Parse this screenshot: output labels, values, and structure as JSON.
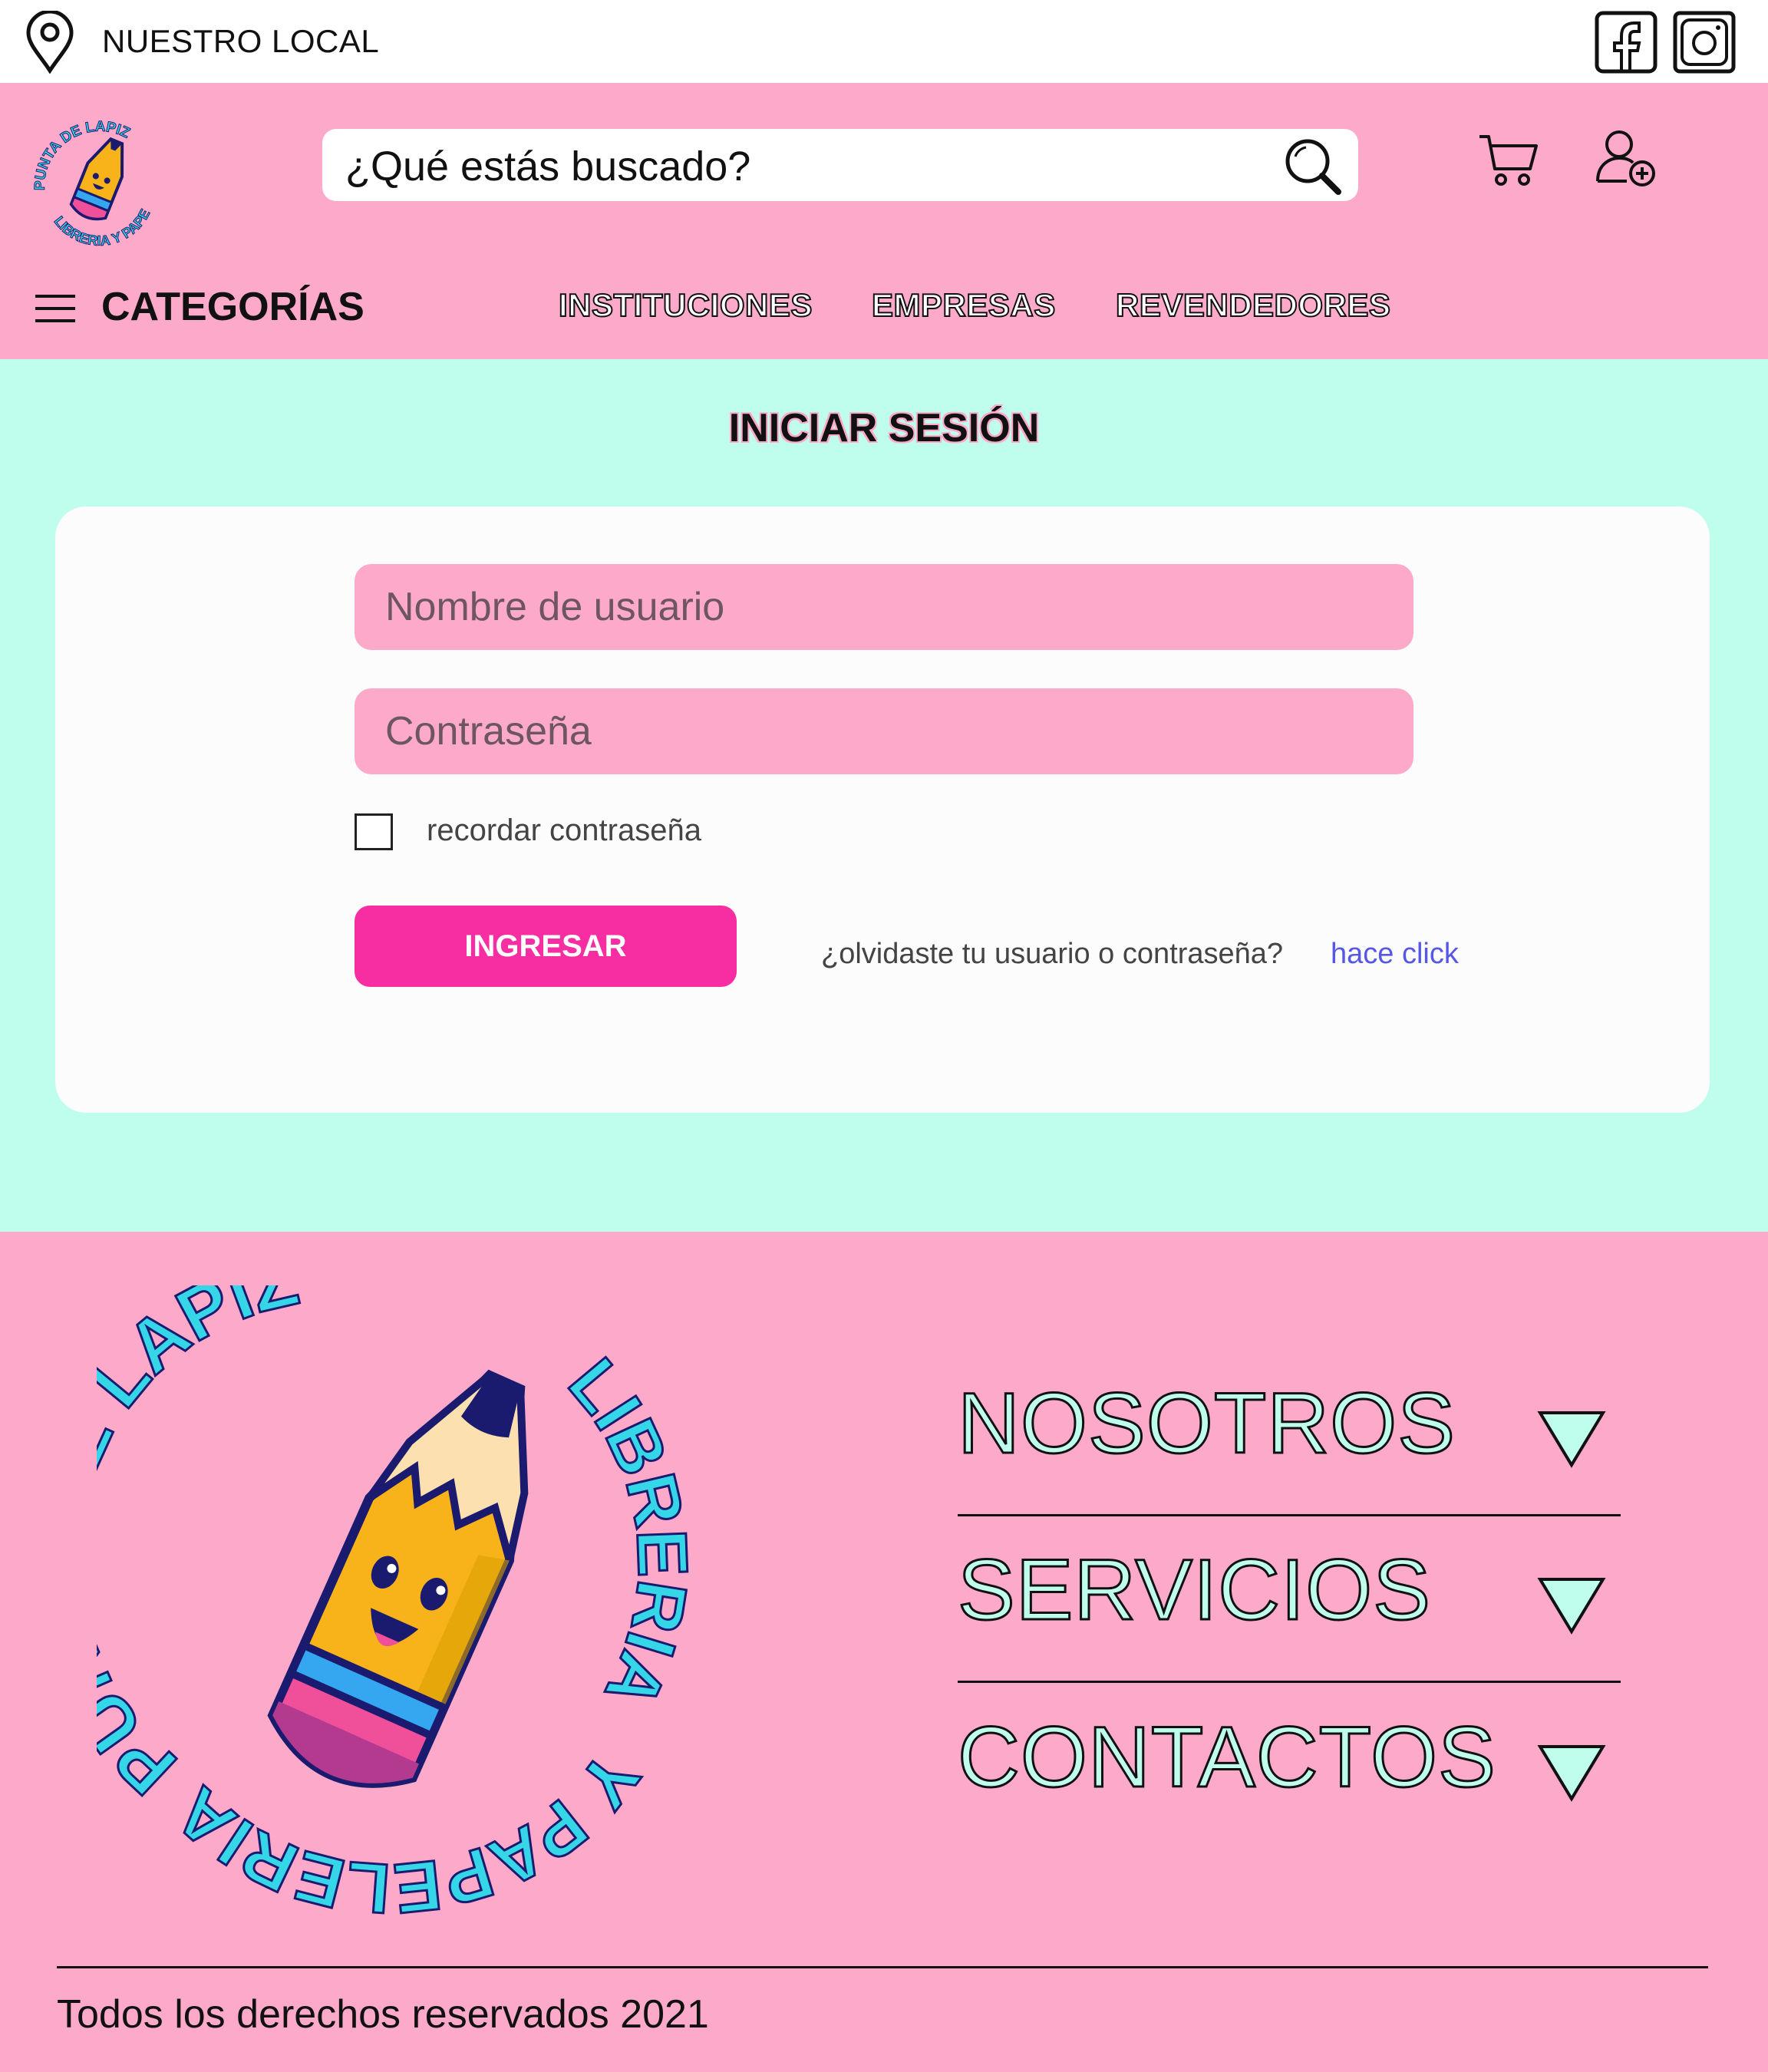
{
  "topbar": {
    "location_label": "NUESTRO LOCAL",
    "location_icon": "location-pin-icon",
    "social": [
      "facebook-icon",
      "instagram-icon"
    ]
  },
  "header": {
    "logo_text_top": "PUNTA DE LAPIZ",
    "logo_text_bottom": "LIBRERIA Y PAPELERIA",
    "search_placeholder": "¿Qué estás buscado?",
    "categories_label": "CATEGORÍAS",
    "nav": [
      "INSTITUCIONES",
      "EMPRESAS",
      "REVENDEDORES"
    ]
  },
  "login": {
    "title": "INICIAR SESIÓN",
    "username_placeholder": "Nombre de usuario",
    "password_placeholder": "Contraseña",
    "remember_label": "recordar contraseña",
    "submit_label": "INGRESAR",
    "forgot_text": "¿olvidaste tu usuario o contraseña?",
    "forgot_link": "hace click"
  },
  "footer": {
    "sections": [
      "NOSOTROS",
      "SERVICIOS",
      "CONTACTOS"
    ],
    "copyright": "Todos los derechos reservados 2021"
  },
  "colors": {
    "pink": "#fdaaca",
    "mint": "#bffdec",
    "hot_pink": "#f72ea1",
    "link_blue": "#5656e8",
    "logo_cyan": "#35d6e8"
  }
}
